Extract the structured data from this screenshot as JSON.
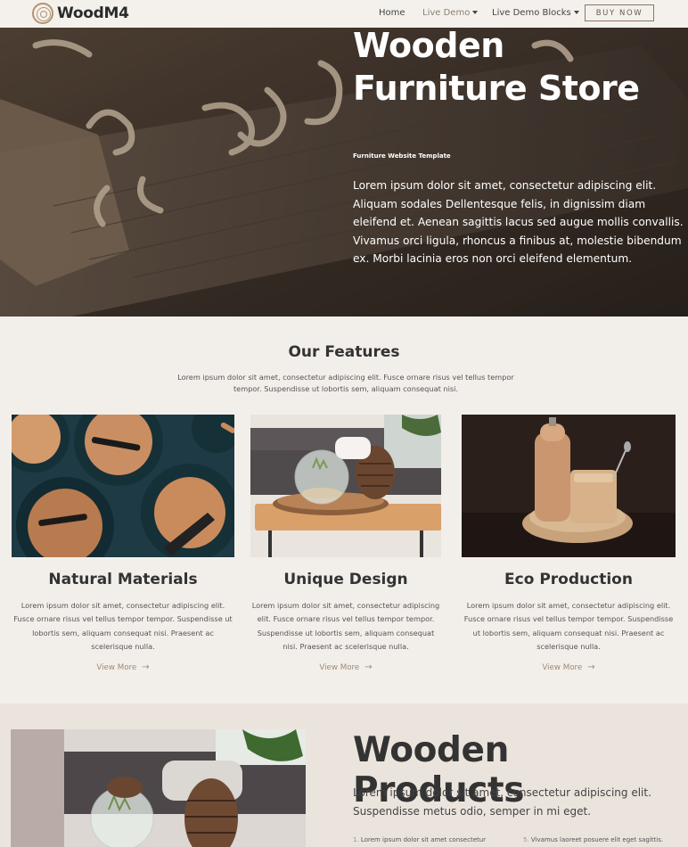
{
  "brand": {
    "name": "WoodM4"
  },
  "nav": {
    "items": [
      {
        "label": "Home"
      },
      {
        "label": "Live Demo"
      },
      {
        "label": "Live Demo Blocks"
      }
    ],
    "cta": "BUY NOW"
  },
  "hero": {
    "title_line1": "Wooden",
    "title_line2": "Furniture Store",
    "subtitle": "Furniture Website Template",
    "body": "Lorem ipsum dolor sit amet, consectetur adipiscing elit. Aliquam sodales Dellentesque felis, in dignissim diam eleifend et. Aenean sagittis lacus sed augue mollis convallis. Vivamus orci ligula, rhoncus a finibus at, molestie bibendum ex. Morbi lacinia eros non orci eleifend elementum."
  },
  "features": {
    "title": "Our Features",
    "intro": "Lorem ipsum dolor sit amet, consectetur adipiscing elit. Fusce ornare risus vel tellus tempor tempor. Suspendisse ut lobortis sem, aliquam consequat nisi.",
    "cards": [
      {
        "title": "Natural Materials",
        "text": "Lorem ipsum dolor sit amet, consectetur adipiscing elit. Fusce ornare risus vel tellus tempor tempor. Suspendisse ut lobortis sem, aliquam consequat nisi. Praesent ac scelerisque nulla.",
        "link": "View More"
      },
      {
        "title": "Unique Design",
        "text": "Lorem ipsum dolor sit amet, consectetur adipiscing elit. Fusce ornare risus vel tellus tempor tempor. Suspendisse ut lobortis sem, aliquam consequat nisi. Praesent ac scelerisque nulla.",
        "link": "View More"
      },
      {
        "title": "Eco Production",
        "text": "Lorem ipsum dolor sit amet, consectetur adipiscing elit. Fusce ornare risus vel tellus tempor tempor. Suspendisse ut lobortis sem, aliquam consequat nisi. Praesent ac scelerisque nulla.",
        "link": "View More"
      }
    ]
  },
  "products": {
    "title": "Wooden Products",
    "body": "Lorem ipsum dolor sit amet, consectetur adipiscing elit. Suspendisse metus odio, semper in mi eget.",
    "list_a_num": "1.",
    "list_a": "Lorem ipsum dolor sit amet consectetur",
    "list_b_num": "5.",
    "list_b": "Vivamus laoreet posuere elit eget sagittis."
  },
  "colors": {
    "background": "#f2efea",
    "accent": "#a08a73",
    "products_bg": "#ebe4dd"
  },
  "icons": [
    "logo-rings-icon",
    "chevron-down-icon",
    "arrow-right-icon"
  ]
}
